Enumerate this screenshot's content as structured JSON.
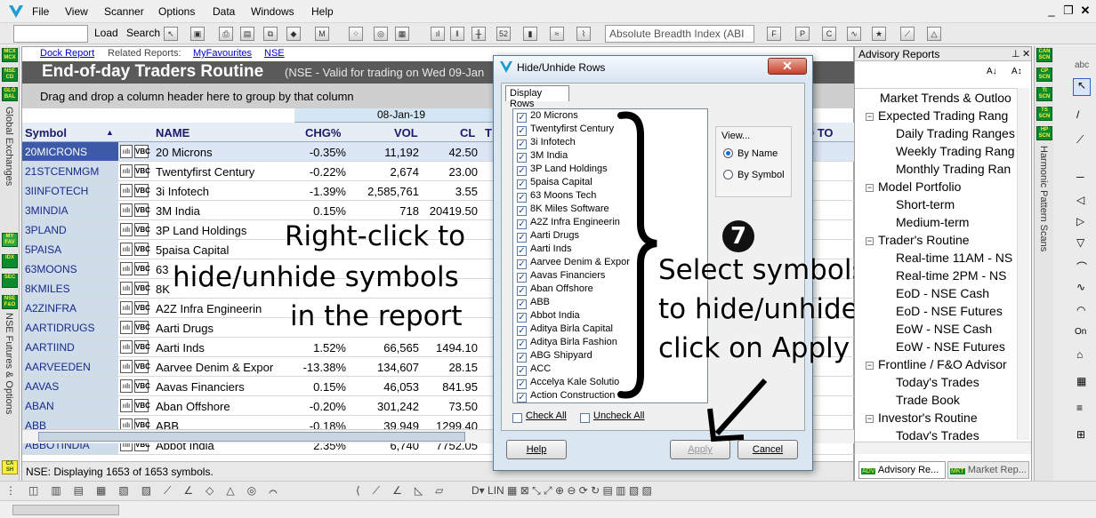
{
  "menu": {
    "items": [
      "File",
      "View",
      "Scanner",
      "Options",
      "Data",
      "Windows",
      "Help"
    ]
  },
  "toolbar": {
    "load_label": "Load",
    "search_label": "Search",
    "indicator_combo": "Absolute Breadth Index (ABI"
  },
  "left_strip": {
    "badges": [
      "MCX MCX",
      "NSE CD",
      "GLO BAL",
      "MY FAV",
      "IDX",
      "SEC",
      "NSE F&O"
    ],
    "vtext_top": "Global Exchanges",
    "vtext_bottom": "NSE Futures & Options",
    "bottom_badge": "CA SH"
  },
  "report": {
    "links": {
      "dock": "Dock Report",
      "related_prefix": "Related Reports:",
      "myfav": "MyFavourites",
      "nse": "NSE"
    },
    "title": "End-of-day Traders Routine",
    "subtitle": "(NSE - Valid for trading on Wed 09-Jan",
    "group_hint": "Drag and drop a column header here to group by that column",
    "date_header": "08-Jan-19",
    "columns": {
      "symbol": "Symbol",
      "name": "NAME",
      "chg": "CHG%",
      "vol": "VOL",
      "cl": "CL",
      "t": "T",
      "oto": "O TO"
    },
    "rows": [
      {
        "sym": "20MICRONS",
        "i1": "ıılı",
        "i2": "VBC",
        "name": "20 Microns",
        "chg": "-0.35%",
        "vol": "11,192",
        "cl": "42.50"
      },
      {
        "sym": "21STCENMGM",
        "i1": "ıılı",
        "i2": "VBC",
        "name": "Twentyfirst Century",
        "chg": "-0.22%",
        "vol": "2,674",
        "cl": "23.00"
      },
      {
        "sym": "3IINFOTECH",
        "i1": "ıılı",
        "i2": "VBC",
        "name": "3i Infotech",
        "chg": "-1.39%",
        "vol": "2,585,761",
        "cl": "3.55"
      },
      {
        "sym": "3MINDIA",
        "i1": "ıılı",
        "i2": "VBC",
        "name": "3M India",
        "chg": "0.15%",
        "vol": "718",
        "cl": "20419.50"
      },
      {
        "sym": "3PLAND",
        "i1": "ıılı",
        "i2": "VBC",
        "name": "3P Land Holdings",
        "chg": "",
        "vol": "",
        "cl": ""
      },
      {
        "sym": "5PAISA",
        "i1": "ıılı",
        "i2": "VBC",
        "name": "5paisa Capital",
        "chg": "",
        "vol": "",
        "cl": ""
      },
      {
        "sym": "63MOONS",
        "i1": "ıılı",
        "i2": "VBC",
        "name": "63",
        "chg": "",
        "vol": "",
        "cl": ""
      },
      {
        "sym": "8KMILES",
        "i1": "ıılı",
        "i2": "VBC",
        "name": "8K",
        "chg": "",
        "vol": "",
        "cl": ""
      },
      {
        "sym": "A2ZINFRA",
        "i1": "ıılı",
        "i2": "VBC",
        "name": "A2Z Infra Engineerin",
        "chg": "",
        "vol": "",
        "cl": ""
      },
      {
        "sym": "AARTIDRUGS",
        "i1": "ıılı",
        "i2": "VBC",
        "name": "Aarti Drugs",
        "chg": "",
        "vol": "",
        "cl": ""
      },
      {
        "sym": "AARTIIND",
        "i1": "ıılı",
        "i2": "VBC",
        "name": "Aarti Inds",
        "chg": "1.52%",
        "vol": "66,565",
        "cl": "1494.10"
      },
      {
        "sym": "AARVEEDEN",
        "i1": "ıılı",
        "i2": "VBC",
        "name": "Aarvee Denim & Expor",
        "chg": "-13.38%",
        "vol": "134,607",
        "cl": "28.15"
      },
      {
        "sym": "AAVAS",
        "i1": "ıılı",
        "i2": "VBC",
        "name": "Aavas Financiers",
        "chg": "0.15%",
        "vol": "46,053",
        "cl": "841.95"
      },
      {
        "sym": "ABAN",
        "i1": "ıılı",
        "i2": "VBC",
        "name": "Aban Offshore",
        "chg": "-0.20%",
        "vol": "301,242",
        "cl": "73.50"
      },
      {
        "sym": "ABB",
        "i1": "ıılı",
        "i2": "VBC",
        "name": "ABB",
        "chg": "-0.18%",
        "vol": "39,949",
        "cl": "1299.40"
      },
      {
        "sym": "ABBOTINDIA",
        "i1": "ıılı",
        "i2": "VBC",
        "name": "Abbot India",
        "chg": "2.35%",
        "vol": "6,740",
        "cl": "7752.05"
      }
    ],
    "status": "NSE: Displaying 1653 of 1653 symbols."
  },
  "annotations": {
    "left_l1": "Right-click to",
    "left_l2": "hide/unhide symbols",
    "left_l3": "in the report",
    "step": "7",
    "right_l1": "Select symbols",
    "right_l2": "to hide/unhide and",
    "right_l3": "click on Apply"
  },
  "dialog": {
    "title": "Hide/Unhide Rows",
    "tab": "Display Rows",
    "items": [
      "20 Microns",
      "Twentyfirst Century",
      "3i Infotech",
      "3M India",
      "3P Land Holdings",
      "5paisa Capital",
      "63 Moons Tech",
      "8K Miles Software",
      "A2Z Infra Engineerin",
      "Aarti Drugs",
      "Aarti Inds",
      "Aarvee Denim & Expor",
      "Aavas Financiers",
      "Aban Offshore",
      "ABB",
      "Abbot India",
      "Aditya Birla Capital",
      "Aditya Birla Fashion",
      "ABG Shipyard",
      "ACC",
      "Accelya Kale Solutio",
      "Action Construction"
    ],
    "view_label": "View...",
    "by_name": "By Name",
    "by_symbol": "By Symbol",
    "check_all": "Check All",
    "uncheck_all": "Uncheck All",
    "help": "Help",
    "apply": "Apply",
    "cancel": "Cancel"
  },
  "advisory": {
    "title": "Advisory Reports",
    "tree": [
      {
        "label": "Market Trends & Outloo",
        "level": 0,
        "expand": false
      },
      {
        "label": "Expected Trading Rang",
        "level": 0,
        "expand": true
      },
      {
        "label": "Daily Trading Ranges",
        "level": 1
      },
      {
        "label": "Weekly Trading Rang",
        "level": 1
      },
      {
        "label": "Monthly Trading Ran",
        "level": 1
      },
      {
        "label": "Model Portfolio",
        "level": 0,
        "expand": true
      },
      {
        "label": "Short-term",
        "level": 1
      },
      {
        "label": "Medium-term",
        "level": 1
      },
      {
        "label": "Trader's Routine",
        "level": 0,
        "expand": true
      },
      {
        "label": "Real-time 11AM - NS",
        "level": 1
      },
      {
        "label": "Real-time 2PM - NS",
        "level": 1
      },
      {
        "label": "EoD - NSE Cash",
        "level": 1
      },
      {
        "label": "EoD - NSE Futures",
        "level": 1
      },
      {
        "label": "EoW - NSE Cash",
        "level": 1
      },
      {
        "label": "EoW - NSE Futures",
        "level": 1
      },
      {
        "label": "Frontline / F&O Advisor",
        "level": 0,
        "expand": true
      },
      {
        "label": "Today's Trades",
        "level": 1
      },
      {
        "label": "Trade Book",
        "level": 1
      },
      {
        "label": "Investor's Routine",
        "level": 0,
        "expand": true
      },
      {
        "label": "Today's Trades",
        "level": 1
      }
    ],
    "tab_advisory": "Advisory Re...",
    "tab_market": "Market Rep...",
    "strip_badges": [
      "CAN SCN",
      "CP SCN",
      "TI SCN",
      "TS SCN",
      "HP SCN"
    ],
    "strip_vtext": "Harmonic Pattern Scans"
  }
}
